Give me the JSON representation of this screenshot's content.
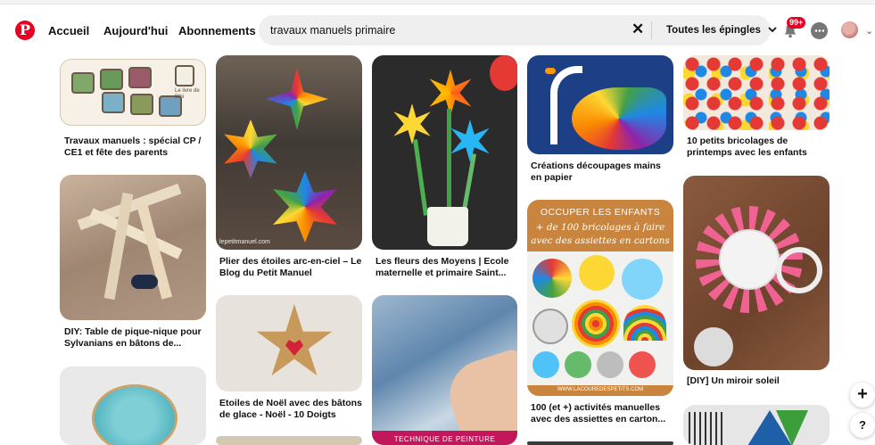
{
  "header": {
    "logo_icon": "pinterest-logo-icon",
    "nav": [
      "Accueil",
      "Aujourd'hui",
      "Abonnements"
    ],
    "search": {
      "value": "travaux manuels primaire",
      "filter": "Toutes les épingles"
    },
    "notifications_badge": "99+",
    "icons": [
      "clear-icon",
      "chevron-down-icon",
      "bell-icon",
      "chat-icon",
      "avatar",
      "account-chevron-icon"
    ]
  },
  "pins": {
    "col1": [
      {
        "title": "Travaux manuels : spécial CP / CE1 et fête des parents",
        "overlay": "Le livre de Bibi"
      },
      {
        "title": "DIY: Table de pique-nique pour Sylvanians en bâtons de...",
        "overlay": ""
      },
      {
        "title": "",
        "overlay": ""
      }
    ],
    "col2": [
      {
        "title": "Plier des étoiles arc-en-ciel – Le Blog du Petit Manuel",
        "overlay": "lepetitmanuel.com"
      },
      {
        "title": "Etoiles de Noël avec des bâtons de glace - Noël - 10 Doigts",
        "overlay": ""
      },
      {
        "title": "",
        "overlay": ""
      }
    ],
    "col3": [
      {
        "title": "Les fleurs des Moyens | Ecole maternelle et primaire Saint...",
        "overlay": ""
      },
      {
        "title": "",
        "overlay": "TECHNIQUE DE PEINTURE"
      }
    ],
    "col4": [
      {
        "title": "Créations découpages mains en papier",
        "overlay": ""
      },
      {
        "title": "100 (et +) activités manuelles avec des assiettes en carton...",
        "overlay_lines": [
          "OCCUPER LES ENFANTS",
          "+ de 100 bricolages à faire",
          "avec des assiettes en cartons"
        ],
        "footer": "WWW.LACOUREDESPETITS.COM"
      },
      {
        "title": "",
        "overlay": ""
      }
    ],
    "col5": [
      {
        "title": "10 petits bricolages de printemps avec les enfants",
        "overlay": ""
      },
      {
        "title": "[DIY] Un miroir soleil",
        "overlay": ""
      },
      {
        "title": "",
        "overlay": ""
      }
    ]
  },
  "fabs": {
    "create": "+",
    "help": "?"
  }
}
